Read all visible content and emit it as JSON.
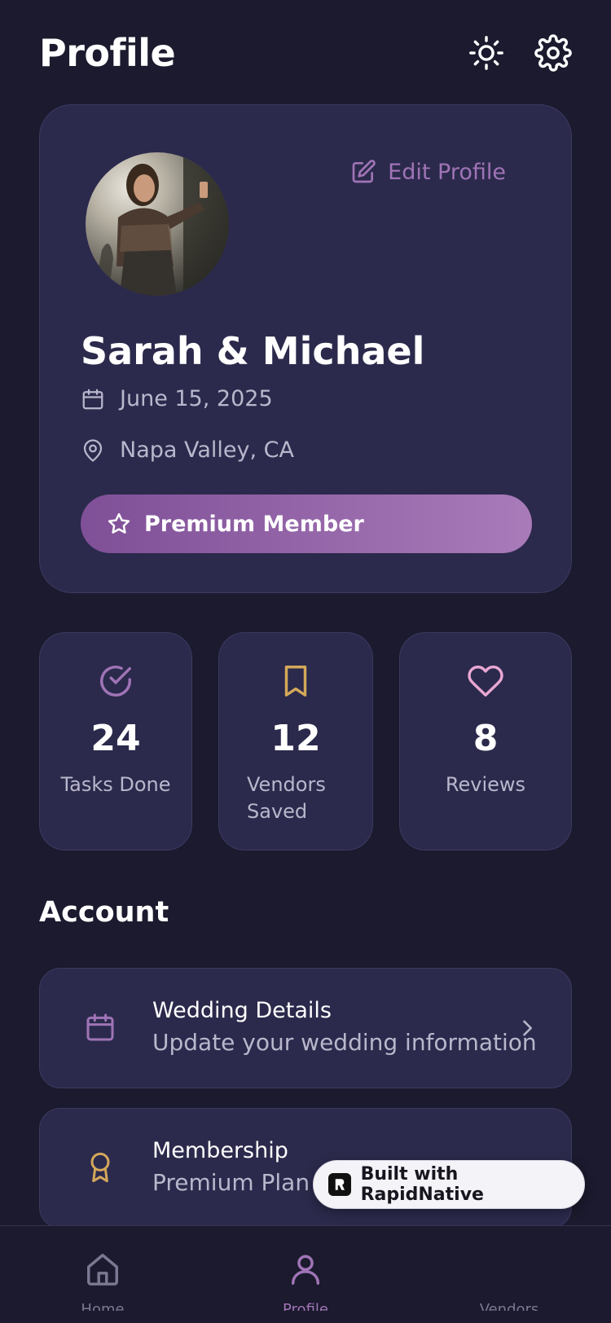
{
  "header": {
    "title": "Profile",
    "theme_icon": "sun-icon",
    "settings_icon": "gear-icon"
  },
  "profile": {
    "edit_label": "Edit Profile",
    "name": "Sarah & Michael",
    "date": "June 15, 2025",
    "location": "Napa Valley, CA",
    "badge": "Premium Member"
  },
  "stats": [
    {
      "icon": "check-circle-icon",
      "value": "24",
      "label": "Tasks Done",
      "color": "#a074b6"
    },
    {
      "icon": "bookmark-icon",
      "value": "12",
      "label": "Vendors Saved",
      "color": "#d4a85a"
    },
    {
      "icon": "heart-icon",
      "value": "8",
      "label": "Reviews",
      "color": "#e9a7d4"
    }
  ],
  "account": {
    "title": "Account",
    "items": [
      {
        "title": "Wedding Details",
        "subtitle": "Update your wedding information",
        "icon": "calendar-icon",
        "color": "#a074b6"
      },
      {
        "title": "Membership",
        "subtitle": "Premium Plan",
        "icon": "award-icon",
        "color": "#d4a85a"
      }
    ]
  },
  "badge": {
    "label": "Built with RapidNative"
  },
  "tabs": [
    {
      "label": "Home",
      "icon": "home-icon"
    },
    {
      "label": "Profile",
      "icon": "user-icon",
      "active": true
    },
    {
      "label": "Vendors",
      "icon": "store-icon"
    }
  ],
  "colors": {
    "background": "#1b1a2e",
    "card": "#2b2a4c",
    "accent": "#a074b6",
    "gold": "#d4a85a"
  }
}
